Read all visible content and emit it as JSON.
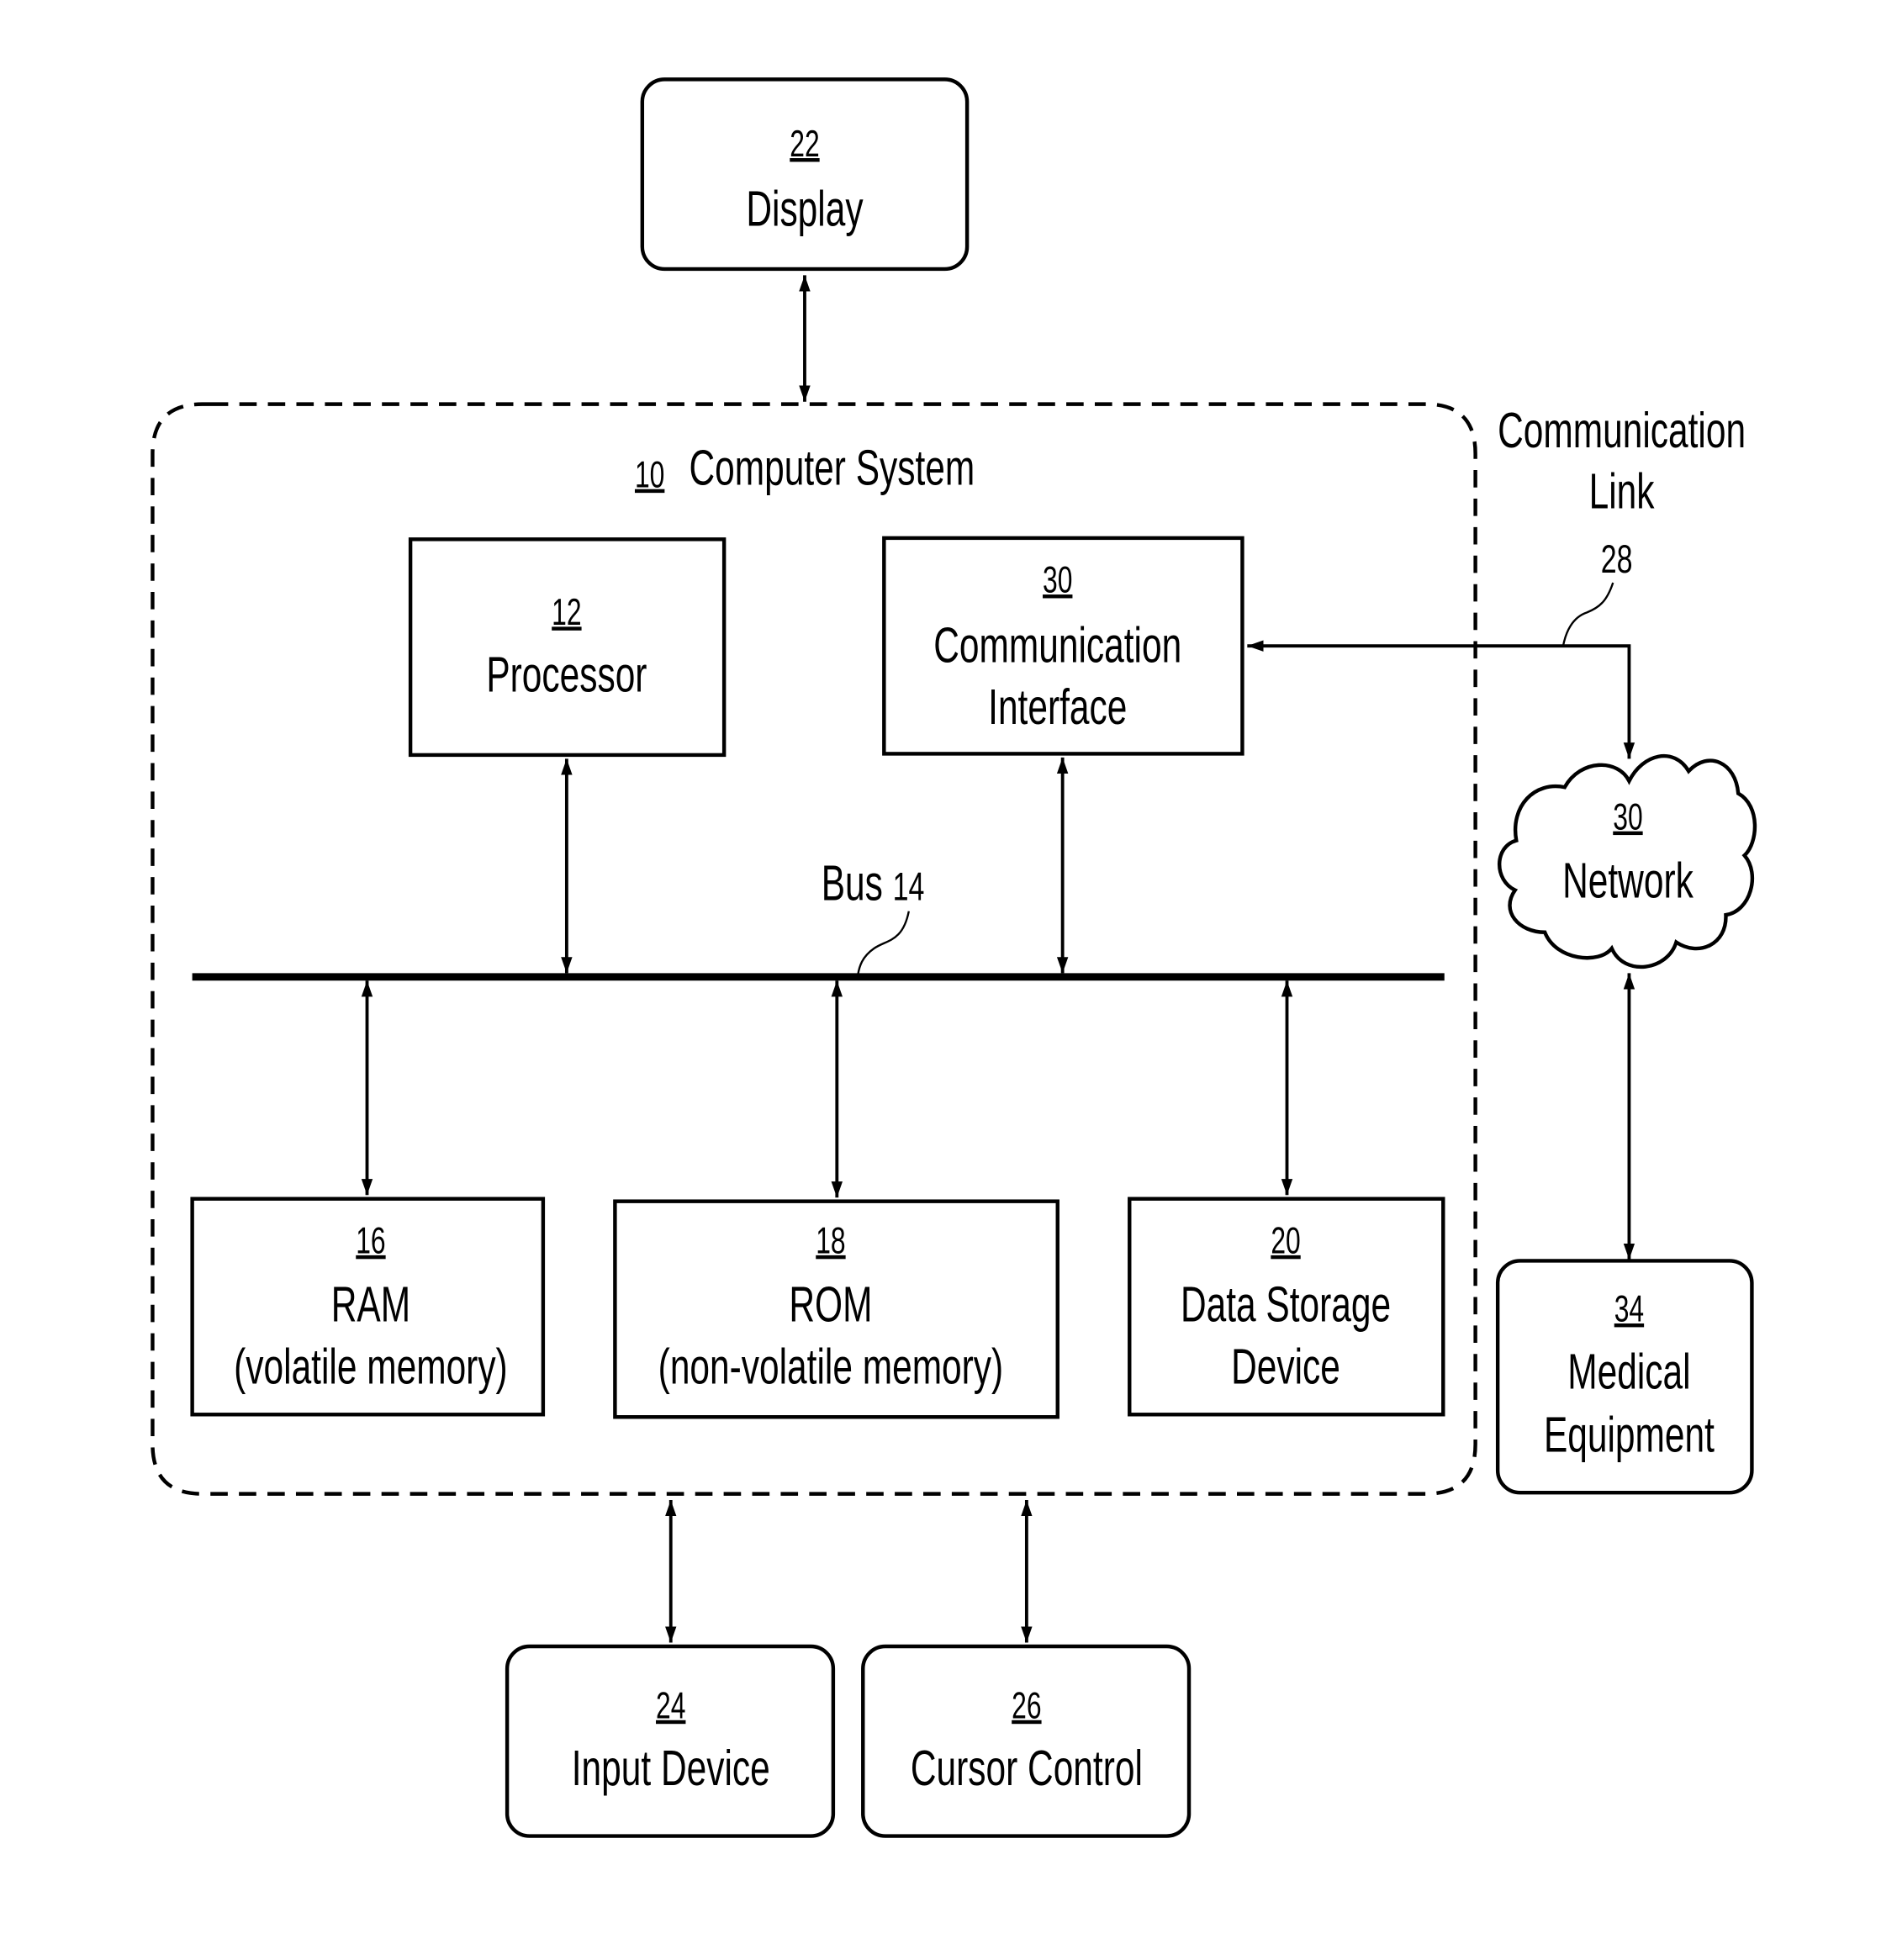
{
  "diagram": {
    "colors": {
      "stroke": "#000000",
      "background": "#ffffff"
    },
    "system": {
      "ref": "10",
      "label": "Computer System"
    },
    "bus": {
      "label": "Bus",
      "ref": "14"
    },
    "comm_link": {
      "label_line1": "Communication",
      "label_line2": "Link",
      "ref": "28"
    },
    "nodes": {
      "display": {
        "ref": "22",
        "lines": [
          "Display"
        ]
      },
      "processor": {
        "ref": "12",
        "lines": [
          "Processor"
        ]
      },
      "comm_interface": {
        "ref": "30",
        "lines": [
          "Communication",
          "Interface"
        ]
      },
      "ram": {
        "ref": "16",
        "lines": [
          "RAM",
          "(volatile memory)"
        ]
      },
      "rom": {
        "ref": "18",
        "lines": [
          "ROM",
          "(non-volatile memory)"
        ]
      },
      "storage": {
        "ref": "20",
        "lines": [
          "Data Storage",
          "Device"
        ]
      },
      "network": {
        "ref": "30",
        "lines": [
          "Network"
        ]
      },
      "medical": {
        "ref": "34",
        "lines": [
          "Medical",
          "Equipment"
        ]
      },
      "input": {
        "ref": "24",
        "lines": [
          "Input Device"
        ]
      },
      "cursor": {
        "ref": "26",
        "lines": [
          "Cursor Control"
        ]
      }
    },
    "edges": [
      {
        "from": "display",
        "to": "computer-system",
        "direction": "bidirectional"
      },
      {
        "from": "processor",
        "to": "bus",
        "direction": "bidirectional"
      },
      {
        "from": "comm_interface",
        "to": "bus",
        "direction": "bidirectional"
      },
      {
        "from": "bus",
        "to": "ram",
        "direction": "bidirectional"
      },
      {
        "from": "bus",
        "to": "rom",
        "direction": "bidirectional"
      },
      {
        "from": "bus",
        "to": "storage",
        "direction": "bidirectional"
      },
      {
        "from": "comm_interface",
        "to": "network",
        "direction": "bidirectional",
        "via": "comm_link"
      },
      {
        "from": "network",
        "to": "medical",
        "direction": "bidirectional"
      },
      {
        "from": "computer-system",
        "to": "input",
        "direction": "bidirectional"
      },
      {
        "from": "computer-system",
        "to": "cursor",
        "direction": "bidirectional"
      }
    ]
  }
}
